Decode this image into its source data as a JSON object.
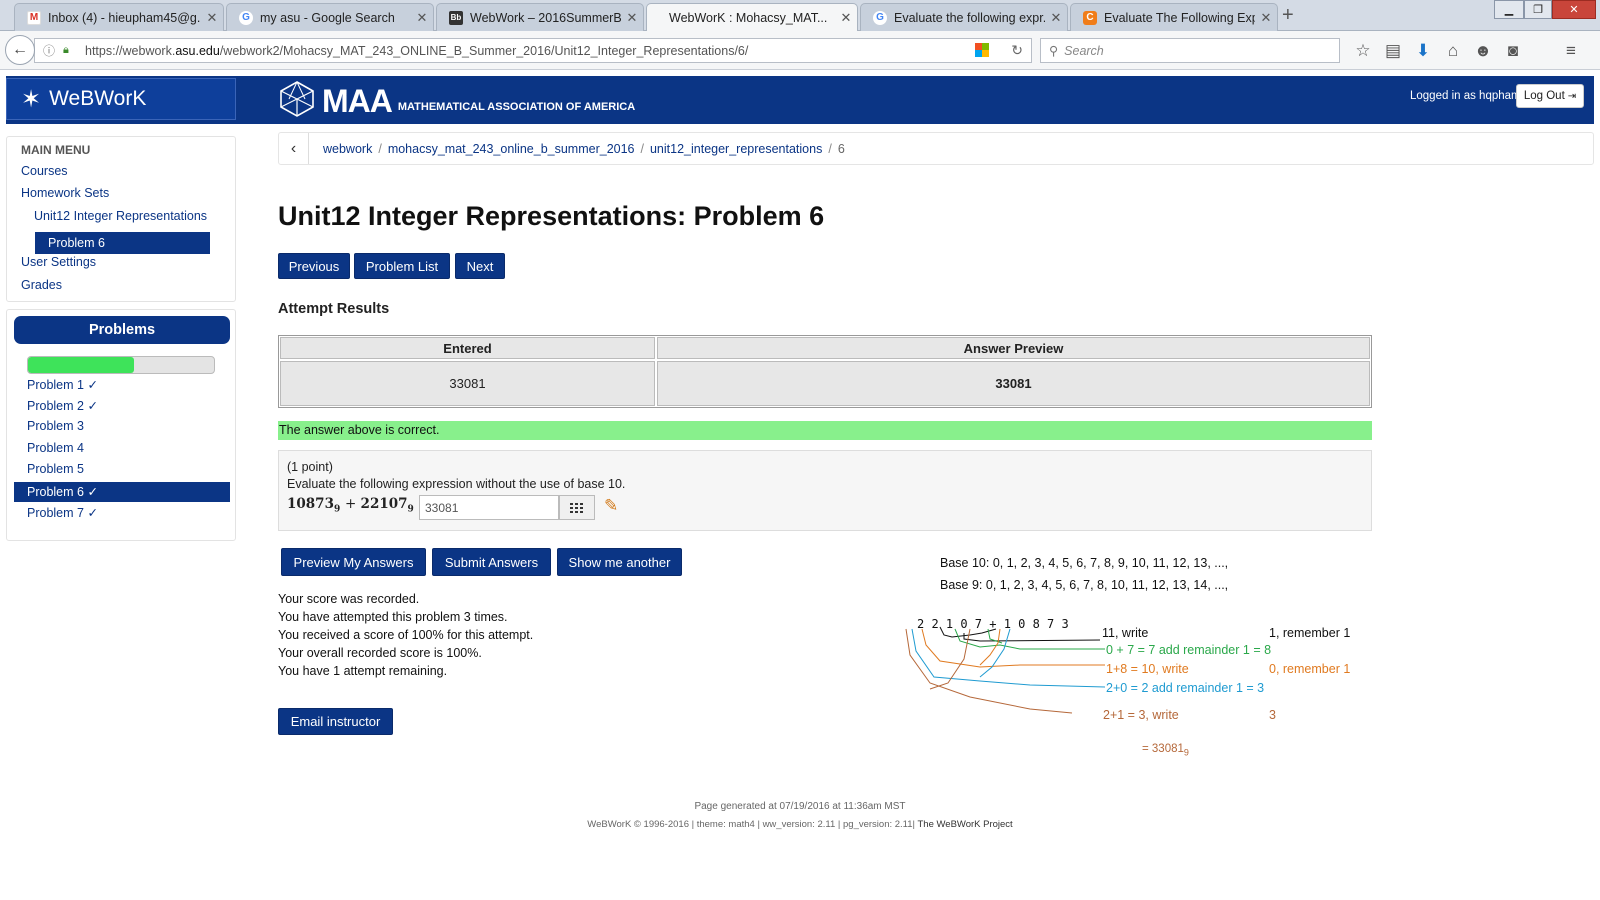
{
  "browser": {
    "tabs": [
      {
        "title": "Inbox (4) - hieupham45@g...",
        "icon": "gmail-icon"
      },
      {
        "title": "my asu - Google Search",
        "icon": "google-icon"
      },
      {
        "title": "WebWork – 2016SummerB...",
        "icon": "blackboard-icon"
      },
      {
        "title": "WebWorK : Mohacsy_MAT...",
        "icon": "",
        "active": true
      },
      {
        "title": "Evaluate the following expr...",
        "icon": "google-icon"
      },
      {
        "title": "Evaluate The Following Exp...",
        "icon": "chegg-icon"
      }
    ],
    "url_prefix": "https://webwork.",
    "url_domain": "asu.edu",
    "url_rest": "/webwork2/Mohacsy_MAT_243_ONLINE_B_Summer_2016/Unit12_Integer_Representations/6/",
    "search_placeholder": "Search"
  },
  "header": {
    "logo_text": "WeBWorK",
    "maa_big": "MAA",
    "maa_small": "MATHEMATICAL ASSOCIATION OF AMERICA",
    "logged_in": "Logged in as hqpham.",
    "logout": "Log Out"
  },
  "sidebar": {
    "main_menu": "MAIN MENU",
    "courses": "Courses",
    "homework_sets": "Homework Sets",
    "set_name": "Unit12 Integer Representations",
    "current_problem": "Problem 6",
    "user_settings": "User Settings",
    "grades": "Grades",
    "problems_title": "Problems",
    "progress": 0.57,
    "problems": [
      {
        "label": "Problem 1 ✓"
      },
      {
        "label": "Problem 2 ✓"
      },
      {
        "label": "Problem 3"
      },
      {
        "label": "Problem 4"
      },
      {
        "label": "Problem 5"
      },
      {
        "label": "Problem 6 ✓",
        "active": true
      },
      {
        "label": "Problem 7 ✓"
      }
    ]
  },
  "breadcrumb": {
    "items": [
      "webwork",
      "mohacsy_mat_243_online_b_summer_2016",
      "unit12_integer_representations"
    ],
    "current": "6"
  },
  "main": {
    "title": "Unit12 Integer Representations: Problem 6",
    "nav_previous": "Previous",
    "nav_list": "Problem List",
    "nav_next": "Next",
    "attempt_heading": "Attempt Results",
    "col_entered": "Entered",
    "col_preview": "Answer Preview",
    "entered_value": "33081",
    "preview_value": "33081",
    "correct_msg": "The answer above is correct.",
    "points": "(1 point)",
    "question": "Evaluate the following expression without the use of base 10.",
    "expr_a": "10873",
    "expr_b": "22107",
    "expr_base": "9",
    "answer_value": "33081",
    "btn_preview": "Preview My Answers",
    "btn_submit": "Submit Answers",
    "btn_another": "Show me another",
    "score_lines": [
      "Your score was recorded.",
      "You have attempted this problem 3 times.",
      "You received a score of 100% for this attempt.",
      "Your overall recorded score is 100%.",
      "You have 1 attempt remaining."
    ],
    "email_btn": "Email instructor"
  },
  "notes": {
    "base10": "Base 10: 0, 1, 2, 3, 4, 5, 6, 7, 8, 9,  10, 11, 12, 13, ...,",
    "base9": "Base 9:   0, 1, 2, 3, 4, 5, 6, 7, 8, 10, 11, 12, 13, 14, ...,",
    "sum": "2 2 1 0 7   +   1 0 8 7 3",
    "l1a": "11, write",
    "l1b": "1, remember 1",
    "l2": "0 + 7 = 7 add remainder 1 = 8",
    "l3a": "1+8 = 10, write",
    "l3b": "0, remember 1",
    "l4": "2+0 = 2 add remainder 1 =   3",
    "l5a": "2+1 = 3, write",
    "l5b": "3",
    "result": "= 33081",
    "result_base": "9",
    "colors": {
      "black": "#111111",
      "green": "#2aa84a",
      "orange": "#e07a20",
      "blue": "#1f9bd1",
      "brown": "#b5683a"
    }
  },
  "footer": {
    "generated": "Page generated at 07/19/2016 at 11:36am MST",
    "copyright": "WeBWorK © 1996-2016 | theme: math4 | ww_version: 2.11 | pg_version: 2.11|",
    "project": "The WeBWorK Project"
  }
}
